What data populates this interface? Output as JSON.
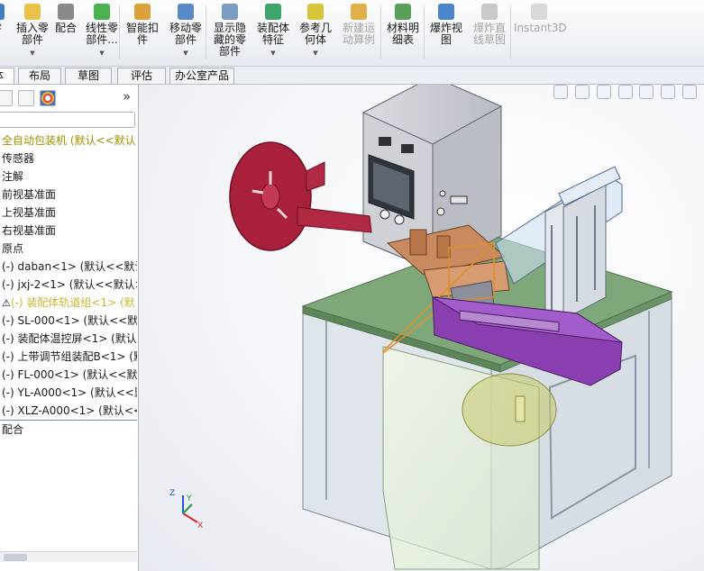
{
  "ribbon": {
    "buttons": [
      {
        "label": "零",
        "disabled": false,
        "dropdown": false,
        "color": "#3f7fbf"
      },
      {
        "label": "插入零\n部件",
        "disabled": false,
        "dropdown": true,
        "color": "#e8c24a"
      },
      {
        "label": "配合",
        "disabled": false,
        "dropdown": false,
        "color": "#8a8a8a"
      },
      {
        "label": "线性零\n部件...",
        "disabled": false,
        "dropdown": true,
        "color": "#4caf50"
      },
      {
        "label": "智能扣\n件",
        "disabled": false,
        "dropdown": false,
        "color": "#d9a23a"
      },
      {
        "label": "移动零\n部件",
        "disabled": false,
        "dropdown": true,
        "color": "#5a89c6"
      },
      {
        "label": "显示隐\n藏的零\n部件",
        "disabled": false,
        "dropdown": false,
        "color": "#7a9bc2"
      },
      {
        "label": "装配体\n特征",
        "disabled": false,
        "dropdown": true,
        "color": "#3fa46a"
      },
      {
        "label": "参考几\n何体",
        "disabled": false,
        "dropdown": true,
        "color": "#d8c43a"
      },
      {
        "label": "新建运\n动算例",
        "disabled": true,
        "dropdown": false,
        "color": "#e0b04a"
      },
      {
        "label": "材料明\n细表",
        "disabled": false,
        "dropdown": false,
        "color": "#5aa05a"
      },
      {
        "label": "爆炸视\n图",
        "disabled": false,
        "dropdown": false,
        "color": "#4a86c8"
      },
      {
        "label": "爆炸直\n线草图",
        "disabled": true,
        "dropdown": false,
        "color": "#c9c9c9"
      },
      {
        "label": "Instant3D",
        "disabled": true,
        "dropdown": false,
        "color": "#d9d9d9"
      }
    ]
  },
  "tabs": [
    {
      "label": "体",
      "active": true
    },
    {
      "label": "布局",
      "active": false
    },
    {
      "label": "草图",
      "active": false
    },
    {
      "label": "评估",
      "active": false
    },
    {
      "label": "办公室产品",
      "active": false
    }
  ],
  "panel": {
    "collapse_label": "»",
    "tree": [
      {
        "label": "全自动包装机 (默认<<默认",
        "kind": "root"
      },
      {
        "label": "传感器",
        "kind": "folder"
      },
      {
        "label": "注解",
        "kind": "folder"
      },
      {
        "label": "前视基准面",
        "kind": "plane"
      },
      {
        "label": "上视基准面",
        "kind": "plane"
      },
      {
        "label": "右视基准面",
        "kind": "plane"
      },
      {
        "label": "原点",
        "kind": "origin"
      },
      {
        "label": "(-) daban<1> (默认<<默认",
        "kind": "part"
      },
      {
        "label": "(-) jxj-2<1> (默认<<默认>",
        "kind": "part"
      },
      {
        "label": "(-) 装配体轨道组<1> (默",
        "kind": "warn"
      },
      {
        "label": "(-) SL-000<1> (默认<<默",
        "kind": "part"
      },
      {
        "label": "(-) 装配体温控屏<1> (默认",
        "kind": "part"
      },
      {
        "label": "(-) 上带调节组装配B<1> (默",
        "kind": "part"
      },
      {
        "label": "(-) FL-000<1> (默认<<默",
        "kind": "part"
      },
      {
        "label": "(-) YL-A000<1> (默认<<默",
        "kind": "part"
      },
      {
        "label": "(-) XLZ-A000<1> (默认<<",
        "kind": "part"
      },
      {
        "label": "配合",
        "kind": "mate"
      }
    ]
  },
  "triad": {
    "x": "X",
    "y": "Y",
    "z": "Z"
  },
  "colors": {
    "table": "#7fa87a",
    "electric_box": "#cfd1d6",
    "reel": "#a8203a",
    "rail": "#8a3fb0",
    "copper": "#c98a60",
    "frame": "#c7cdd6"
  }
}
